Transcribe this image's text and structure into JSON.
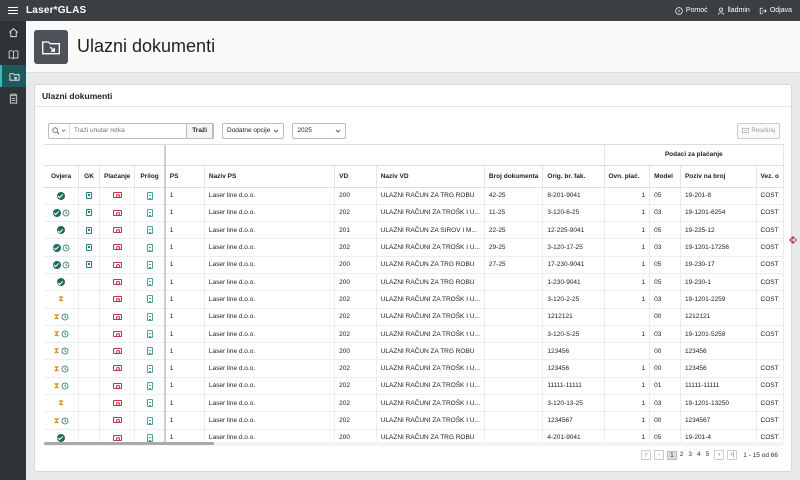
{
  "app": {
    "title": "Laser*GLAS",
    "help_label": "Pomoć",
    "user_label": "lladmin",
    "logout_label": "Odjava"
  },
  "sidenav": [
    {
      "name": "home-icon",
      "active": false
    },
    {
      "name": "book-icon",
      "active": false
    },
    {
      "name": "folder-in-icon",
      "active": true
    },
    {
      "name": "clipboard-icon",
      "active": false
    }
  ],
  "page": {
    "title": "Ulazni dokumenti"
  },
  "region": {
    "title": "Ulazni dokumenti"
  },
  "toolbar": {
    "search_placeholder": "Traži unutar retka",
    "go_label": "Traži",
    "actions_label": "Dodatne opcije",
    "year_value": "2025",
    "reset_label": "Resetiraj"
  },
  "grid": {
    "group_header": "Podaci za plaćanje",
    "columns": [
      "Ovjera",
      "GK",
      "Plaćanje",
      "Prilog",
      "PS",
      "Naziv PS",
      "VD",
      "Naziv VD",
      "Broj dokumenta",
      "Orig. br. fak.",
      "Ovn. plać.",
      "Model",
      "Poziv na broj",
      "Vez. o"
    ],
    "rows": [
      {
        "ovjera": [
          "ok"
        ],
        "gk": true,
        "pay": true,
        "doc": true,
        "ps": "1",
        "naziv_ps": "Laser line d.o.o.",
        "vd": "200",
        "naziv_vd": "ULAZNI RAČUN ZA TRG ROBU",
        "broj": "42-25",
        "orig": "8-201-9041",
        "ovn": "1",
        "model": "05",
        "poziv": "19-201-8",
        "vez": "COST"
      },
      {
        "ovjera": [
          "ok",
          "history"
        ],
        "gk": true,
        "pay": true,
        "doc": true,
        "ps": "1",
        "naziv_ps": "Laser line d.o.o.",
        "vd": "202",
        "naziv_vd": "ULAZNI RAČUNI ZA TROŠK I U...",
        "broj": "11-25",
        "orig": "3-120-6-25",
        "ovn": "1",
        "model": "03",
        "poziv": "19-1201-6254",
        "vez": "COST"
      },
      {
        "ovjera": [
          "ok"
        ],
        "gk": true,
        "pay": true,
        "doc": true,
        "ps": "1",
        "naziv_ps": "Laser line d.o.o.",
        "vd": "201",
        "naziv_vd": "ULAZNI RAČUN ZA SIROV I M...",
        "broj": "22-25",
        "orig": "12-225-9041",
        "ovn": "1",
        "model": "05",
        "poziv": "19-225-12",
        "vez": "COST"
      },
      {
        "ovjera": [
          "ok",
          "history"
        ],
        "gk": true,
        "pay": true,
        "doc": true,
        "ps": "1",
        "naziv_ps": "Laser line d.o.o.",
        "vd": "202",
        "naziv_vd": "ULAZNI RAČUNI ZA TROŠK I U...",
        "broj": "29-25",
        "orig": "3-120-17-25",
        "ovn": "1",
        "model": "03",
        "poziv": "19-1201-17256",
        "vez": "COST"
      },
      {
        "ovjera": [
          "ok",
          "history"
        ],
        "gk": true,
        "pay": true,
        "doc": true,
        "ps": "1",
        "naziv_ps": "Laser line d.o.o.",
        "vd": "200",
        "naziv_vd": "ULAZNI RAČUN ZA TRG ROBU",
        "broj": "27-25",
        "orig": "17-230-9041",
        "ovn": "1",
        "model": "05",
        "poziv": "19-230-17",
        "vez": "COST"
      },
      {
        "ovjera": [
          "ok"
        ],
        "gk": false,
        "pay": true,
        "doc": true,
        "ps": "1",
        "naziv_ps": "Laser line d.o.o.",
        "vd": "200",
        "naziv_vd": "ULAZNI RAČUN ZA TRG ROBU",
        "broj": "",
        "orig": "1-230-9041",
        "ovn": "1",
        "model": "05",
        "poziv": "19-230-1",
        "vez": "COST"
      },
      {
        "ovjera": [
          "hourglass"
        ],
        "gk": false,
        "pay": true,
        "doc": true,
        "ps": "1",
        "naziv_ps": "Laser line d.o.o.",
        "vd": "202",
        "naziv_vd": "ULAZNI RAČUNI ZA TROŠK I U...",
        "broj": "",
        "orig": "3-120-2-25",
        "ovn": "1",
        "model": "03",
        "poziv": "19-1201-2259",
        "vez": "COST"
      },
      {
        "ovjera": [
          "hourglass",
          "history"
        ],
        "gk": false,
        "pay": true,
        "doc": true,
        "ps": "1",
        "naziv_ps": "Laser line d.o.o.",
        "vd": "202",
        "naziv_vd": "ULAZNI RAČUNI ZA TROŠK I U...",
        "broj": "",
        "orig": "1212121",
        "ovn": "",
        "model": "00",
        "poziv": "1212121",
        "vez": ""
      },
      {
        "ovjera": [
          "hourglass",
          "history"
        ],
        "gk": false,
        "pay": true,
        "doc": true,
        "ps": "1",
        "naziv_ps": "Laser line d.o.o.",
        "vd": "202",
        "naziv_vd": "ULAZNI RAČUNI ZA TROŠK I U...",
        "broj": "",
        "orig": "3-120-5-25",
        "ovn": "1",
        "model": "03",
        "poziv": "19-1201-5258",
        "vez": "COST"
      },
      {
        "ovjera": [
          "hourglass",
          "history"
        ],
        "gk": false,
        "pay": true,
        "doc": true,
        "ps": "1",
        "naziv_ps": "Laser line d.o.o.",
        "vd": "200",
        "naziv_vd": "ULAZNI RAČUN ZA TRG ROBU",
        "broj": "",
        "orig": "123456",
        "ovn": "",
        "model": "00",
        "poziv": "123456",
        "vez": ""
      },
      {
        "ovjera": [
          "hourglass",
          "history"
        ],
        "gk": false,
        "pay": true,
        "doc": true,
        "ps": "1",
        "naziv_ps": "Laser line d.o.o.",
        "vd": "202",
        "naziv_vd": "ULAZNI RAČUNI ZA TROŠK I U...",
        "broj": "",
        "orig": "123456",
        "ovn": "1",
        "model": "00",
        "poziv": "123456",
        "vez": "COST"
      },
      {
        "ovjera": [
          "hourglass",
          "history"
        ],
        "gk": false,
        "pay": true,
        "doc": true,
        "ps": "1",
        "naziv_ps": "Laser line d.o.o.",
        "vd": "202",
        "naziv_vd": "ULAZNI RAČUNI ZA TROŠK I U...",
        "broj": "",
        "orig": "11111-11111",
        "ovn": "1",
        "model": "01",
        "poziv": "11111-11111",
        "vez": "COST"
      },
      {
        "ovjera": [
          "hourglass"
        ],
        "gk": false,
        "pay": true,
        "doc": true,
        "ps": "1",
        "naziv_ps": "Laser line d.o.o.",
        "vd": "202",
        "naziv_vd": "ULAZNI RAČUNI ZA TROŠK I U...",
        "broj": "",
        "orig": "3-120-13-25",
        "ovn": "1",
        "model": "03",
        "poziv": "19-1201-13250",
        "vez": "COST"
      },
      {
        "ovjera": [
          "hourglass",
          "history"
        ],
        "gk": false,
        "pay": true,
        "doc": true,
        "ps": "1",
        "naziv_ps": "Laser line d.o.o.",
        "vd": "202",
        "naziv_vd": "ULAZNI RAČUNI ZA TROŠK I U...",
        "broj": "",
        "orig": "1234567",
        "ovn": "1",
        "model": "00",
        "poziv": "1234567",
        "vez": "COST"
      },
      {
        "ovjera": [
          "ok"
        ],
        "gk": false,
        "pay": true,
        "doc": true,
        "ps": "1",
        "naziv_ps": "Laser line d.o.o.",
        "vd": "200",
        "naziv_vd": "ULAZNI RAČUN ZA TRG ROBU",
        "broj": "",
        "orig": "4-201-9041",
        "ovn": "1",
        "model": "05",
        "poziv": "19-201-4",
        "vez": "COST"
      }
    ]
  },
  "pagination": {
    "pages": [
      "1",
      "2",
      "3",
      "4",
      "5"
    ],
    "current": "1",
    "range": "1 - 15 od 66"
  },
  "colors": {
    "topbar": "#3a3f44",
    "sidenav": "#2f3336",
    "accent": "#1b6b5e",
    "payment": "#c2344d",
    "pending": "#d39a2a"
  }
}
